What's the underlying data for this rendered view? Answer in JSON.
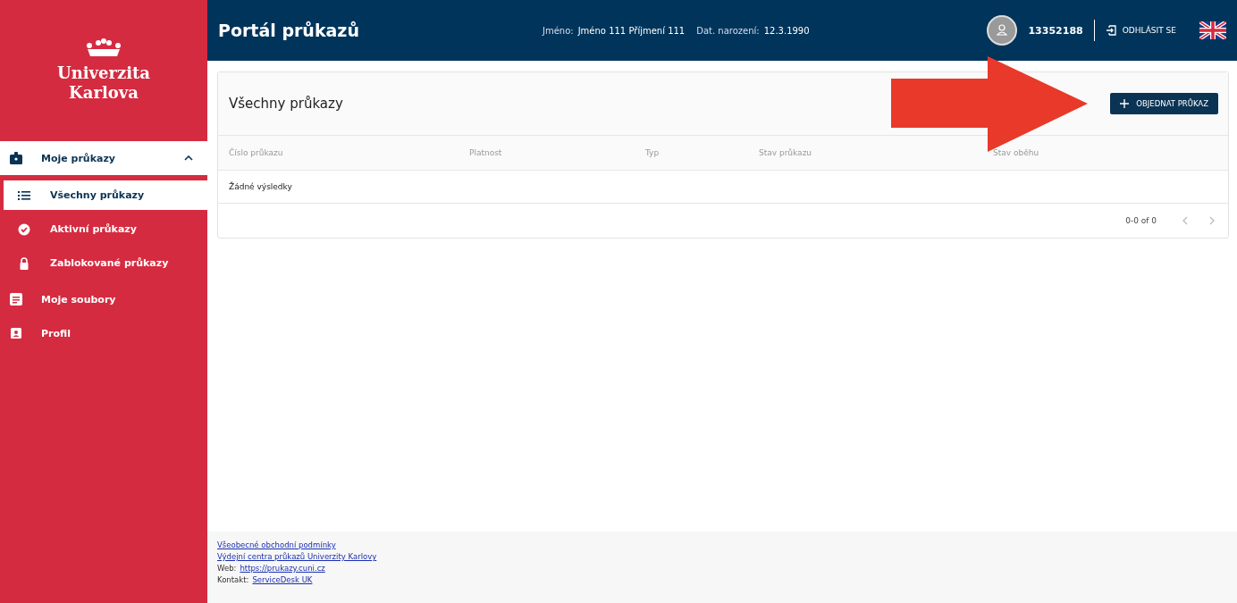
{
  "logo": {
    "line1": "Univerzita",
    "line2": "Karlova"
  },
  "sidebar": {
    "items": [
      {
        "label": "Moje průkazy",
        "expanded": true,
        "children": [
          {
            "label": "Všechny průkazy",
            "selected": true
          },
          {
            "label": "Aktivní průkazy",
            "selected": false
          },
          {
            "label": "Zablokované průkazy",
            "selected": false
          }
        ]
      },
      {
        "label": "Moje soubory"
      },
      {
        "label": "Profil"
      }
    ]
  },
  "header": {
    "title": "Portál průkazů",
    "name_label": "Jméno:",
    "name_value": "Jméno 111 Příjmení 111",
    "birth_label": "Dat. narození:",
    "birth_value": "12.3.1990",
    "user_id": "13352188",
    "logout": "ODHLÁSIT SE"
  },
  "card": {
    "title": "Všechny průkazy",
    "order_button": "OBJEDNAT PRŮKAZ",
    "table": {
      "columns": [
        "Číslo průkazu",
        "Platnost",
        "Typ",
        "Stav průkazu",
        "Stav oběhu"
      ],
      "empty_text": "Žádné výsledky"
    },
    "pagination": {
      "range": "0-0 of 0"
    }
  },
  "footer": [
    {
      "link": "Všeobecné obchodní podmínky"
    },
    {
      "link": "Výdejní centra průkazů Univerzity Karlovy"
    },
    {
      "label": "Web:",
      "link": "https://prukazy.cuni.cz"
    },
    {
      "label": "Kontakt:",
      "link": "ServiceDesk UK"
    }
  ]
}
